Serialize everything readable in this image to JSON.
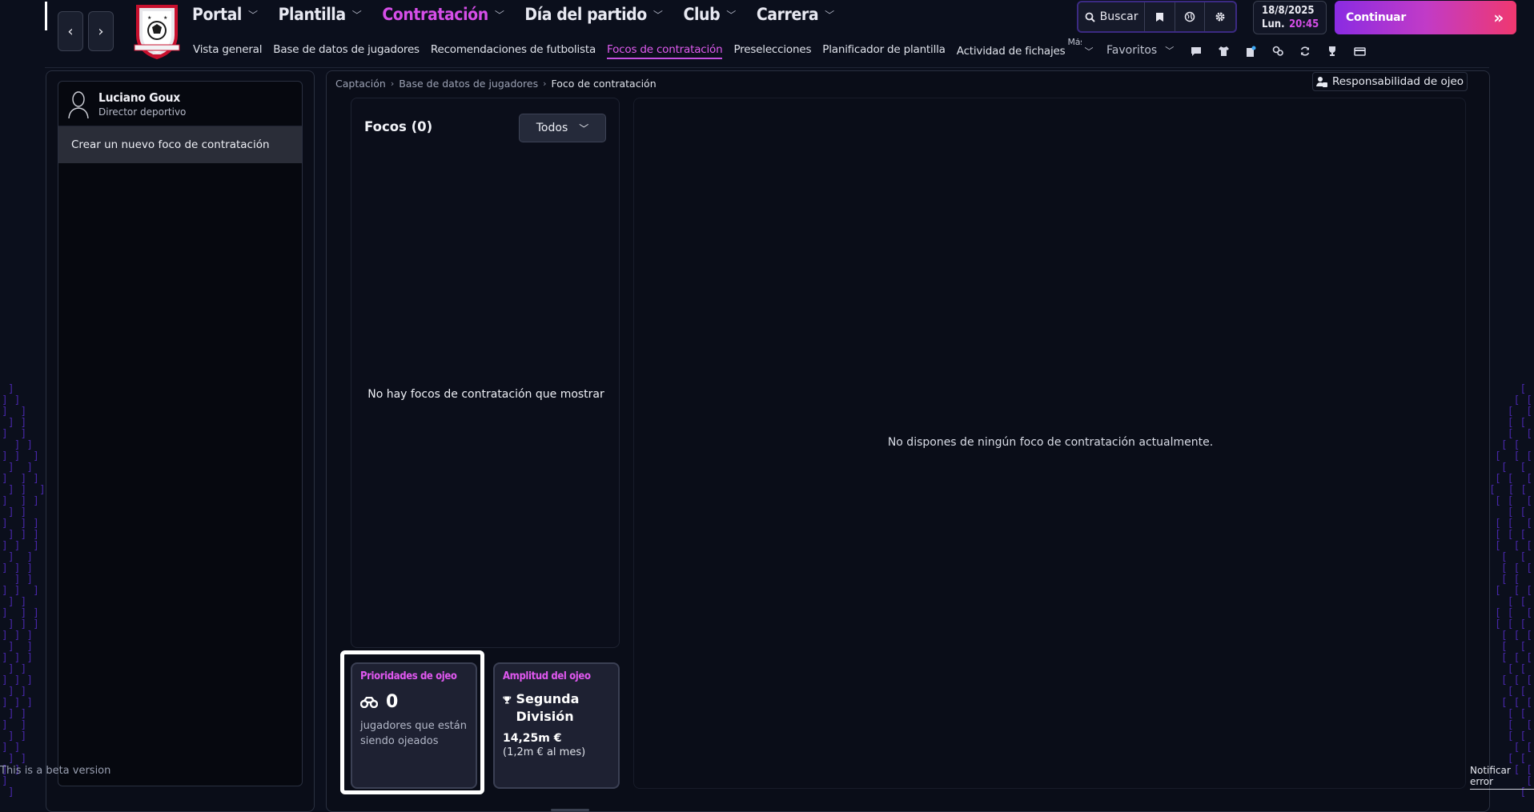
{
  "header": {
    "main_nav": [
      {
        "label": "Portal",
        "active": false
      },
      {
        "label": "Plantilla",
        "active": false
      },
      {
        "label": "Contratación",
        "active": true
      },
      {
        "label": "Día del partido",
        "active": false
      },
      {
        "label": "Club",
        "active": false
      },
      {
        "label": "Carrera",
        "active": false
      }
    ],
    "sub_nav": [
      {
        "label": "Vista general",
        "active": false
      },
      {
        "label": "Base de datos de jugadores",
        "active": false
      },
      {
        "label": "Recomendaciones de futbolista",
        "active": false
      },
      {
        "label": "Focos de contratación",
        "active": true
      },
      {
        "label": "Preselecciones",
        "active": false
      },
      {
        "label": "Planificador de plantilla",
        "active": false
      },
      {
        "label": "Actividad de fichajes",
        "active": false
      }
    ],
    "more_label": "Más",
    "favorites_label": "Favoritos",
    "search_label": "Buscar",
    "date": "18/8/2025",
    "weekday": "Lun.",
    "time": "20:45",
    "continue_label": "Continuar",
    "accent_color": "#d64ee8"
  },
  "sidebar": {
    "name": "Luciano Goux",
    "role": "Director deportivo",
    "new_focus_label": "Crear un nuevo foco de contratación",
    "beta_note": "This is a beta version"
  },
  "breadcrumb": [
    "Captación",
    "Base de datos de jugadores",
    "Foco de contratación"
  ],
  "main": {
    "responsibility_label": "Responsabilidad de ojeo",
    "focus_title": "Focos (0)",
    "filter_value": "Todos",
    "empty_list": "No hay focos de contratación que mostrar",
    "empty_detail": "No dispones de ningún foco de contratación actualmente."
  },
  "cards": {
    "priorities": {
      "title": "Prioridades de ojeo",
      "count": "0",
      "caption": "jugadores que están siendo ojeados"
    },
    "range": {
      "title": "Amplitud del ojeo",
      "division": "Segunda División",
      "budget": "14,25m €",
      "monthly": "(1,2m € al mes)"
    }
  },
  "footer": {
    "report_label": "Notificar error"
  }
}
